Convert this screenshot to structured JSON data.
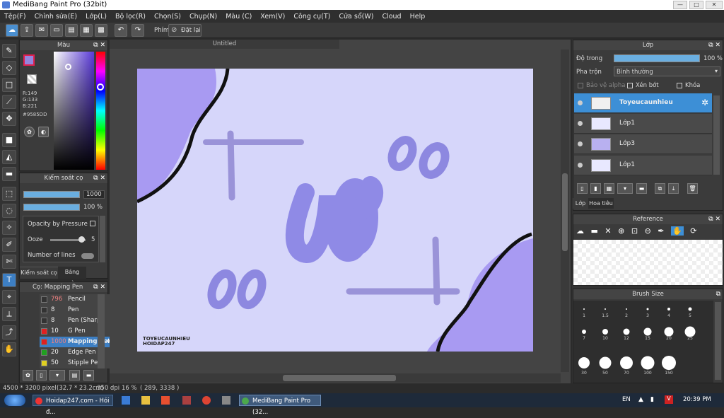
{
  "titlebar": {
    "title": "MediBang Paint Pro (32bit)",
    "min": "—",
    "max": "□",
    "close": "✕"
  },
  "menu": [
    "Tệp(F)",
    "Chỉnh sửa(E)",
    "Lớp(L)",
    "Bộ lọc(R)",
    "Chọn(S)",
    "Chụp(N)",
    "Màu (C)",
    "Xem(V)",
    "Công cụ(T)",
    "Cửa sổ(W)",
    "Cloud",
    "Help"
  ],
  "toolbar": {
    "shortcut_label": "Phím",
    "reset_label": "Đặt lại"
  },
  "color_panel": {
    "title": "Màu",
    "r": "R:149",
    "g": "G:133",
    "b": "B:221",
    "hex": "#9585DD",
    "primary": "#9585DD"
  },
  "brush_control": {
    "title": "Kiểm soát cọ",
    "size": "1000",
    "opacity": "100 %",
    "opacity_pressure": "Opacity by Pressure",
    "ooze_label": "Ooze",
    "ooze_value": "5",
    "lines_label": "Number of lines",
    "tab1": "Kiểm soát cọ",
    "tab2": "Bảng màu"
  },
  "brush_list": {
    "title": "Cọ: Mapping Pen",
    "items": [
      {
        "size": "796",
        "name": "Pencil",
        "color": "#333333"
      },
      {
        "size": "8",
        "name": "Pen",
        "color": "#333333"
      },
      {
        "size": "8",
        "name": "Pen (Sharp)",
        "color": "#333333"
      },
      {
        "size": "10",
        "name": "G Pen",
        "color": "#e02020"
      },
      {
        "size": "1000",
        "name": "Mapping Pen",
        "color": "#e02020"
      },
      {
        "size": "20",
        "name": "Edge Pen",
        "color": "#20a020"
      },
      {
        "size": "50",
        "name": "Stipple Pen",
        "color": "#e0d020"
      }
    ]
  },
  "canvas": {
    "tab_title": "Untitled",
    "signature_line1": "TOYEUCAUNHIEU",
    "signature_line2": "HOIDAP247"
  },
  "layer_panel": {
    "title": "Lớp",
    "opacity_label": "Độ trong",
    "opacity_value": "100 %",
    "opacity_fraction": 1.0,
    "blend_label": "Pha trộn",
    "blend_value": "Bình thường",
    "protect_alpha": "Bảo vệ alpha",
    "clipping": "Xén bớt",
    "lock": "Khóa",
    "layers": [
      {
        "name": "Toyeucaunhieu",
        "selected": true
      },
      {
        "name": "Lớp1",
        "selected": false
      },
      {
        "name": "Lớp3",
        "selected": false
      },
      {
        "name": "Lớp1",
        "selected": false
      }
    ],
    "tab1": "Lớp",
    "tab2": "Hoa tiêu"
  },
  "reference_panel": {
    "title": "Reference"
  },
  "brush_size_panel": {
    "title": "Brush Size",
    "sizes": [
      "1",
      "1.5",
      "2",
      "3",
      "4",
      "5",
      "7",
      "10",
      "12",
      "15",
      "20",
      "25",
      "30",
      "50",
      "70",
      "100",
      "150"
    ]
  },
  "status": {
    "dims": "4500 * 3200 pixel",
    "physical": "(32.7 * 23.2cm)",
    "dpi": "350 dpi",
    "zoom": "16 %",
    "coords": "( 289, 3338 )"
  },
  "taskbar": {
    "item1": "Hoidap247.com - Hỏi đ...",
    "item2": "MediBang Paint Pro (32...",
    "lang": "EN",
    "time": "20:39 PM"
  }
}
